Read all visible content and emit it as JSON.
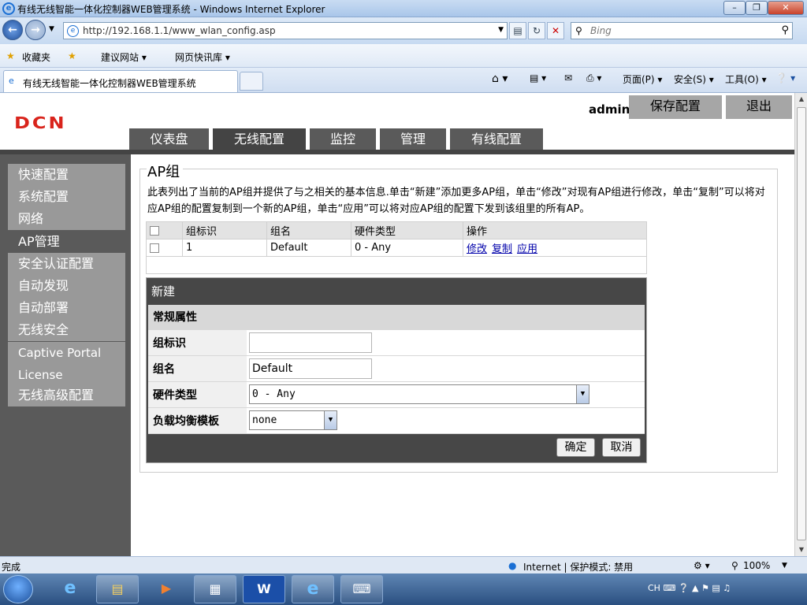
{
  "window": {
    "title": "有线无线智能一体化控制器WEB管理系统 - Windows Internet Explorer"
  },
  "addressbar": {
    "url": "http://192.168.1.1/www_wlan_config.asp",
    "search_placeholder": "Bing"
  },
  "favorites": {
    "favorites_label": "收藏夹",
    "suggested_label": "建议网站 ▾",
    "webslice_label": "网页快讯库 ▾"
  },
  "tab": {
    "title": "有线无线智能一体化控制器WEB管理系统"
  },
  "commandbar": {
    "page": "页面(P) ▾",
    "safety": "安全(S) ▾",
    "tools": "工具(O) ▾"
  },
  "header": {
    "logo": "DCN",
    "user": "admin",
    "save_label": "保存配置",
    "logout_label": "退出"
  },
  "nav_tabs": [
    "仪表盘",
    "无线配置",
    "监控",
    "管理",
    "有线配置"
  ],
  "sidebar": {
    "items": [
      "快速配置",
      "系统配置",
      "网络",
      "AP管理",
      "安全认证配置",
      "自动发现",
      "自动部署",
      "无线安全",
      "Captive Portal",
      "License",
      "无线高级配置"
    ]
  },
  "content": {
    "title": "AP组",
    "description": "此表列出了当前的AP组并提供了与之相关的基本信息.单击“新建”添加更多AP组，单击“修改”对现有AP组进行修改，单击“复制”可以将对应AP组的配置复制到一个新的AP组，单击“应用”可以将对应AP组的配置下发到该组里的所有AP。",
    "table": {
      "headers": [
        "组标识",
        "组名",
        "硬件类型",
        "操作"
      ],
      "rows": [
        {
          "id": "1",
          "name": "Default",
          "hw": "0 - Any",
          "actions": [
            "修改",
            "复制",
            "应用"
          ]
        }
      ]
    },
    "new": {
      "title": "新建",
      "section": "常规属性",
      "id_label": "组标识",
      "id_value": "",
      "name_label": "组名",
      "name_value": "Default",
      "hw_label": "硬件类型",
      "hw_value": "0 - Any",
      "lb_label": "负载均衡模板",
      "lb_value": "none",
      "ok_label": "确定",
      "cancel_label": "取消"
    }
  },
  "statusbar": {
    "status": "完成",
    "zone": "Internet | 保护模式: 禁用",
    "zoom": "100%"
  },
  "taskbar": {
    "tray_text": "CH"
  }
}
